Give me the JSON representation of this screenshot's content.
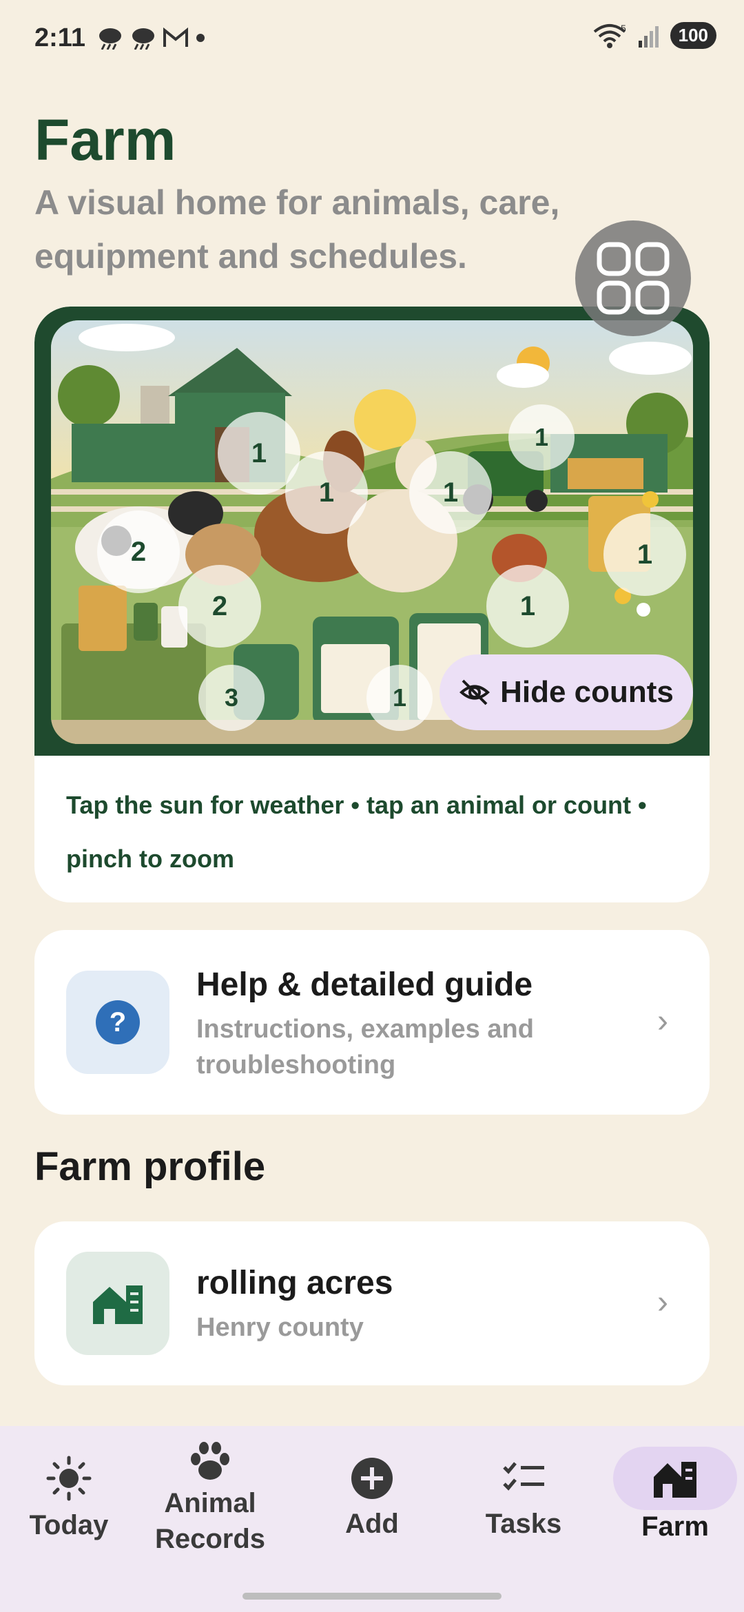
{
  "status": {
    "time": "2:11",
    "wifi_label": "5",
    "battery": "100"
  },
  "header": {
    "title": "Farm",
    "subtitle": "A visual home for animals, care, equipment and schedules."
  },
  "hero": {
    "counts": {
      "cow": "2",
      "horse": "1",
      "tractor": "1",
      "alpaca": "1",
      "beehive": "1",
      "goat": "2",
      "chicken": "1",
      "medical": "3",
      "calendar": "1"
    },
    "hide_counts_label": "Hide counts",
    "hint": "Tap the sun for weather • tap an animal or count • pinch to zoom"
  },
  "help_card": {
    "title": "Help & detailed guide",
    "subtitle": "Instructions, examples and troubleshooting"
  },
  "farm_profile": {
    "section_title": "Farm profile",
    "name": "rolling acres",
    "location": "Henry county"
  },
  "nav": {
    "items": [
      {
        "label": "Today",
        "icon": "sun-icon"
      },
      {
        "label": "Animal Records",
        "icon": "paw-icon"
      },
      {
        "label": "Add",
        "icon": "add-circle-icon"
      },
      {
        "label": "Tasks",
        "icon": "checklist-icon"
      },
      {
        "label": "Farm",
        "icon": "farm-icon"
      }
    ],
    "active": "Farm"
  },
  "colors": {
    "background": "#f6efe1",
    "primary_green": "#1d4a2e",
    "nav_background": "#f0e8f3",
    "active_pill": "#e3d4f1"
  }
}
